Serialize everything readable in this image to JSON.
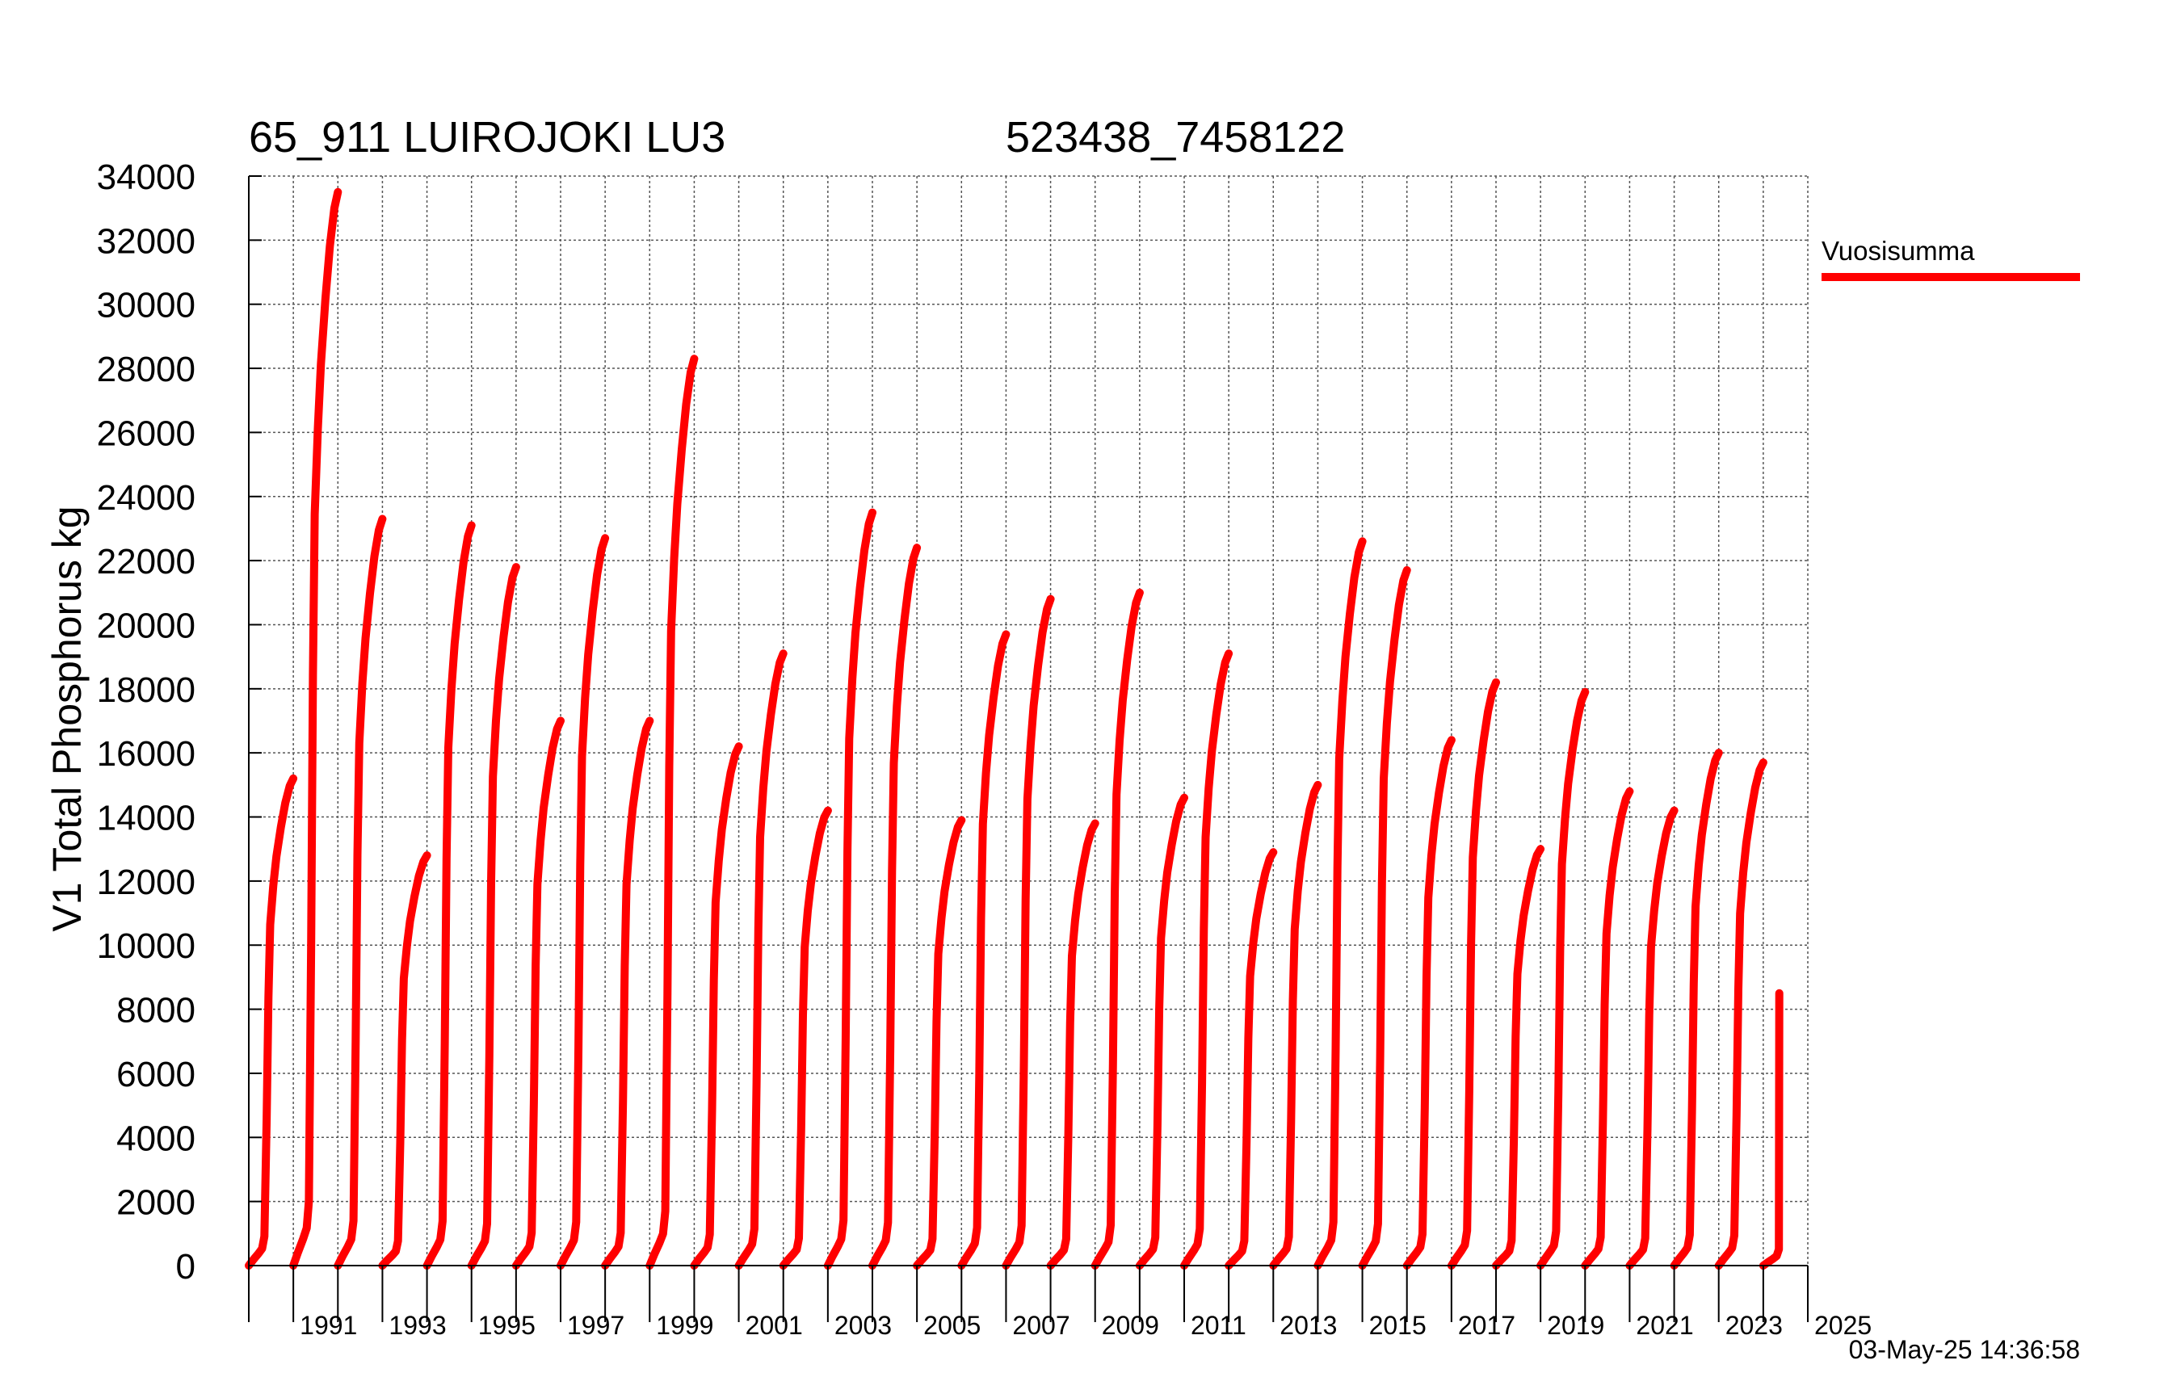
{
  "chart_data": {
    "type": "line",
    "title_left": "65_911 LUIROJOKI LU3",
    "title_right": "523438_7458122",
    "ylabel": "V1 Total Phosphorus kg",
    "xlabel": "",
    "timestamp": "03-May-25 14:36:58",
    "ylim": [
      0,
      34000
    ],
    "xlim": [
      1990,
      2025
    ],
    "yticks": [
      0,
      2000,
      4000,
      6000,
      8000,
      10000,
      12000,
      14000,
      16000,
      18000,
      20000,
      22000,
      24000,
      26000,
      28000,
      30000,
      32000,
      34000
    ],
    "ytick_labels": [
      "0",
      "2000",
      "4000",
      "6000",
      "8000",
      "10000",
      "12000",
      "14000",
      "16000",
      "18000",
      "20000",
      "22000",
      "24000",
      "26000",
      "28000",
      "30000",
      "32000",
      "34000"
    ],
    "xtick_labels": [
      "1991",
      "1993",
      "1995",
      "1997",
      "1999",
      "2001",
      "2003",
      "2005",
      "2007",
      "2009",
      "2011",
      "2013",
      "2015",
      "2017",
      "2019",
      "2021",
      "2023",
      "2025"
    ],
    "grid": true,
    "legend_position": "right",
    "series": [
      {
        "name": "Vuosisumma",
        "color": "#ff0000",
        "annual_totals": [
          {
            "year": 1990,
            "total": 15200
          },
          {
            "year": 1991,
            "total": 33500
          },
          {
            "year": 1992,
            "total": 23300
          },
          {
            "year": 1993,
            "total": 12800
          },
          {
            "year": 1994,
            "total": 23100
          },
          {
            "year": 1995,
            "total": 21800
          },
          {
            "year": 1996,
            "total": 17000
          },
          {
            "year": 1997,
            "total": 22700
          },
          {
            "year": 1998,
            "total": 17000
          },
          {
            "year": 1999,
            "total": 28300
          },
          {
            "year": 2000,
            "total": 16200
          },
          {
            "year": 2001,
            "total": 19100
          },
          {
            "year": 2002,
            "total": 14200
          },
          {
            "year": 2003,
            "total": 23500
          },
          {
            "year": 2004,
            "total": 22400
          },
          {
            "year": 2005,
            "total": 13900
          },
          {
            "year": 2006,
            "total": 19700
          },
          {
            "year": 2007,
            "total": 20800
          },
          {
            "year": 2008,
            "total": 13800
          },
          {
            "year": 2009,
            "total": 21000
          },
          {
            "year": 2010,
            "total": 14600
          },
          {
            "year": 2011,
            "total": 19100
          },
          {
            "year": 2012,
            "total": 12900
          },
          {
            "year": 2013,
            "total": 15000
          },
          {
            "year": 2014,
            "total": 22600
          },
          {
            "year": 2015,
            "total": 21700
          },
          {
            "year": 2016,
            "total": 16400
          },
          {
            "year": 2017,
            "total": 18200
          },
          {
            "year": 2018,
            "total": 13000
          },
          {
            "year": 2019,
            "total": 17900
          },
          {
            "year": 2020,
            "total": 14800
          },
          {
            "year": 2021,
            "total": 14200
          },
          {
            "year": 2022,
            "total": 16000
          },
          {
            "year": 2023,
            "total": 15700
          },
          {
            "year": 2024,
            "total": 8500
          }
        ]
      }
    ]
  }
}
